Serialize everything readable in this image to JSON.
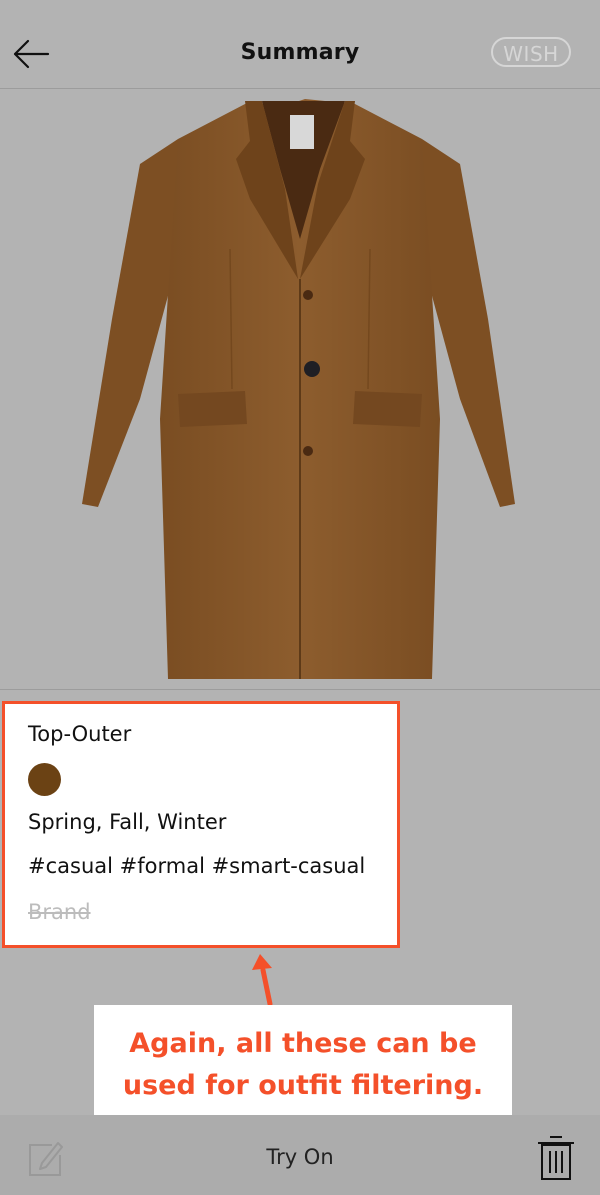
{
  "header": {
    "title": "Summary",
    "wish_label": "WISH"
  },
  "item": {
    "image": "coat",
    "category": "Top-Outer",
    "color_hex": "#6b4214",
    "seasons": "Spring, Fall, Winter",
    "tags": "#casual #formal #smart-casual",
    "brand_placeholder": "Brand"
  },
  "annotation": {
    "line1": "Again, all these can be",
    "line2": "used for outfit filtering."
  },
  "bottom_bar": {
    "try_on_label": "Try On"
  },
  "icons": {
    "back": "back-arrow-icon",
    "edit": "edit-icon",
    "delete": "trash-icon"
  },
  "colors": {
    "background": "#b3b3b3",
    "accent": "#f4502a",
    "coat": "#8a5a2c"
  }
}
